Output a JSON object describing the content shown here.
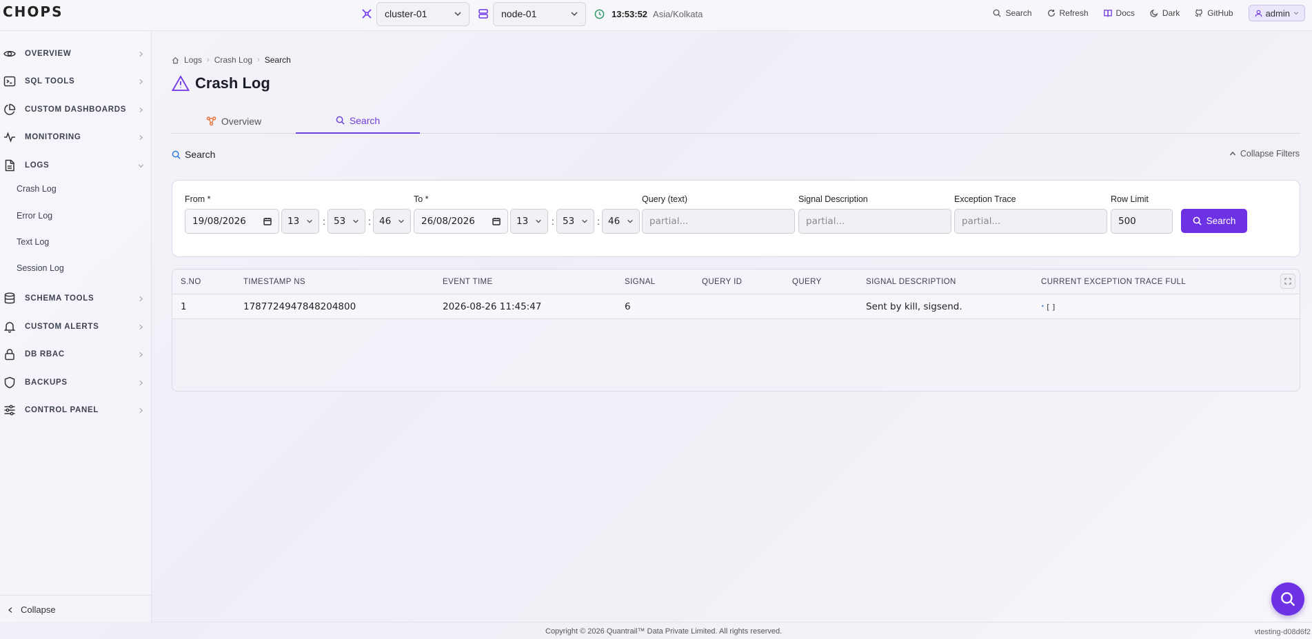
{
  "app": {
    "logo": "CHOPS"
  },
  "topbar": {
    "cluster": "cluster-01",
    "node": "node-01",
    "time": "13:53:52",
    "timezone": "Asia/Kolkata",
    "links": {
      "search": "Search",
      "refresh": "Refresh",
      "docs": "Docs",
      "dark": "Dark",
      "github": "GitHub"
    },
    "user": "admin"
  },
  "sidebar": {
    "items": [
      {
        "label": "OVERVIEW",
        "icon": "eye-icon"
      },
      {
        "label": "SQL TOOLS",
        "icon": "terminal-icon"
      },
      {
        "label": "CUSTOM DASHBOARDS",
        "icon": "pie-chart-icon"
      },
      {
        "label": "MONITORING",
        "icon": "activity-icon"
      },
      {
        "label": "LOGS",
        "icon": "file-icon",
        "expanded": true
      },
      {
        "label": "SCHEMA TOOLS",
        "icon": "database-icon"
      },
      {
        "label": "CUSTOM ALERTS",
        "icon": "bell-icon"
      },
      {
        "label": "DB RBAC",
        "icon": "lock-icon"
      },
      {
        "label": "BACKUPS",
        "icon": "shield-icon"
      },
      {
        "label": "CONTROL PANEL",
        "icon": "sliders-icon"
      }
    ],
    "logs_sub": [
      "Crash Log",
      "Error Log",
      "Text Log",
      "Session Log"
    ],
    "collapse": "Collapse"
  },
  "breadcrumb": [
    "Logs",
    "Crash Log",
    "Search"
  ],
  "page": {
    "title": "Crash Log"
  },
  "tabs": [
    {
      "label": "Overview",
      "active": false
    },
    {
      "label": "Search",
      "active": true
    }
  ],
  "search_section": {
    "title": "Search",
    "collapse_filters": "Collapse Filters"
  },
  "filters": {
    "from_label": "From *",
    "from_date": "19/08/2026",
    "from_h": "13",
    "from_m": "53",
    "from_s": "46",
    "to_label": "To *",
    "to_date": "26/08/2026",
    "to_h": "13",
    "to_m": "53",
    "to_s": "46",
    "query_label": "Query (text)",
    "query_placeholder": "partial...",
    "signal_label": "Signal Description",
    "signal_placeholder": "partial...",
    "exception_label": "Exception Trace",
    "exception_placeholder": "partial...",
    "row_limit_label": "Row Limit",
    "row_limit": "500",
    "search_button": "Search"
  },
  "table": {
    "columns": [
      "S.NO",
      "TIMESTAMP NS",
      "EVENT TIME",
      "SIGNAL",
      "QUERY ID",
      "QUERY",
      "SIGNAL DESCRIPTION",
      "CURRENT EXCEPTION TRACE FULL"
    ],
    "rows": [
      {
        "sno": "1",
        "timestamp_ns": "1787724947848204800",
        "event_time": "2026-08-26 11:45:47",
        "signal": "6",
        "query_id": "",
        "query": "",
        "signal_description": "Sent by kill, sigsend.",
        "trace": "[ ]"
      }
    ]
  },
  "footer": {
    "copyright": "Copyright © 2026 Quantrail™ Data Private Limited. All rights reserved.",
    "version": "vtesting-d08d6f2"
  },
  "colors": {
    "accent": "#6d32e4",
    "accent_text": "#6d3ee0",
    "orange_icon": "#e8763a"
  }
}
